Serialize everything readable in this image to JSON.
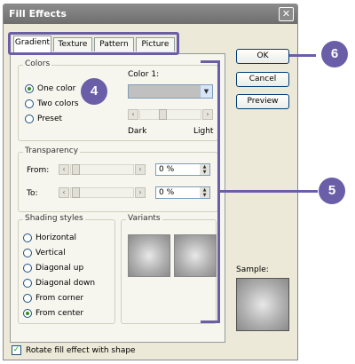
{
  "dialog": {
    "title": "Fill Effects",
    "close_glyph": "✕"
  },
  "tabs": [
    {
      "label": "Gradient",
      "selected": true
    },
    {
      "label": "Texture",
      "selected": false
    },
    {
      "label": "Pattern",
      "selected": false
    },
    {
      "label": "Picture",
      "selected": false
    }
  ],
  "colors_group": {
    "label": "Colors",
    "options": [
      {
        "label": "One color",
        "selected": true
      },
      {
        "label": "Two colors",
        "selected": false
      },
      {
        "label": "Preset",
        "selected": false
      }
    ],
    "color1_label": "Color 1:",
    "color1_value_color": "#c0c0c0",
    "dark_label": "Dark",
    "light_label": "Light"
  },
  "transparency": {
    "label": "Transparency",
    "from_label": "From:",
    "to_label": "To:",
    "from_value": "0 %",
    "to_value": "0 %"
  },
  "shading": {
    "label": "Shading styles",
    "options": [
      {
        "label": "Horizontal",
        "selected": false
      },
      {
        "label": "Vertical",
        "selected": false
      },
      {
        "label": "Diagonal up",
        "selected": false
      },
      {
        "label": "Diagonal down",
        "selected": false
      },
      {
        "label": "From corner",
        "selected": false
      },
      {
        "label": "From center",
        "selected": true
      }
    ]
  },
  "variants": {
    "label": "Variants"
  },
  "sample": {
    "label": "Sample:"
  },
  "buttons": {
    "ok": "OK",
    "cancel": "Cancel",
    "preview": "Preview"
  },
  "rotate_checkbox": {
    "label": "Rotate fill effect with shape",
    "checked": true
  },
  "callouts": {
    "c4": "4",
    "c5": "5",
    "c6": "6"
  },
  "colors": {
    "callout": "#6a5ea8",
    "dialog_bg": "#ece9d8",
    "titlebar": "#7a7a7a"
  }
}
